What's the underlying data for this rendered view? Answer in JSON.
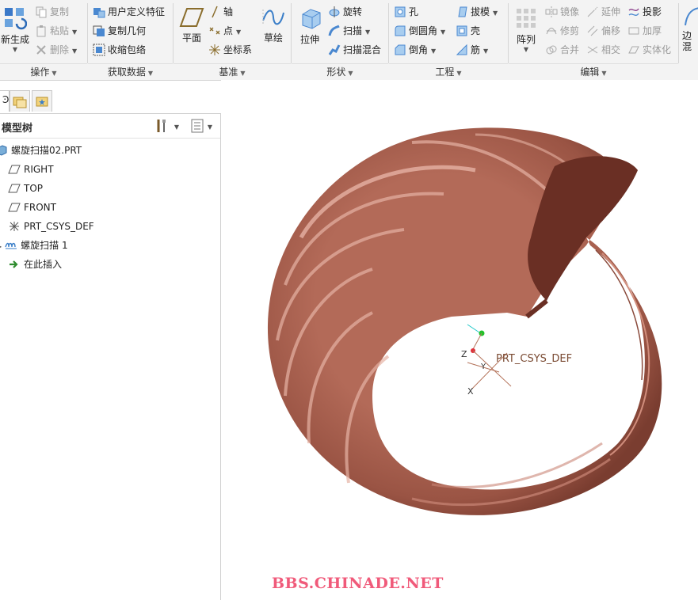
{
  "ribbon": {
    "operations": {
      "group_label": "操作",
      "regenerate_label": "新生成",
      "copy_label": "复制",
      "paste_label": "粘贴",
      "delete_label": "删除"
    },
    "get_data": {
      "group_label": "获取数据",
      "udf_label": "用户定义特征",
      "copy_geom_label": "复制几何",
      "shrinkwrap_label": "收缩包络"
    },
    "datum": {
      "group_label": "基准",
      "plane_label": "平面",
      "axis_label": "轴",
      "point_label": "点",
      "csys_label": "坐标系",
      "sketch_label": "草绘"
    },
    "shapes": {
      "group_label": "形状",
      "extrude_label": "拉伸",
      "revolve_label": "旋转",
      "sweep_label": "扫描",
      "swept_blend_label": "扫描混合"
    },
    "engineering": {
      "group_label": "工程",
      "hole_label": "孔",
      "round_label": "倒圆角",
      "chamfer_label": "倒角",
      "draft_label": "拔模",
      "shell_label": "壳",
      "rib_label": "筋"
    },
    "editing": {
      "group_label": "编辑",
      "pattern_label": "阵列",
      "mirror_label": "镜像",
      "trim_label": "修剪",
      "merge_label": "合并",
      "extend_label": "延伸",
      "offset_label": "偏移",
      "intersect_label": "相交",
      "project_label": "投影",
      "thicken_label": "加厚",
      "solidify_label": "实体化"
    },
    "surfaces": {
      "boundary_label_1": "边",
      "boundary_label_2": "混"
    }
  },
  "left_panel": {
    "tree_title": "模型树",
    "items": [
      {
        "label": "螺旋扫描02.PRT",
        "icon": "part-icon"
      },
      {
        "label": "RIGHT",
        "icon": "datum-plane-icon"
      },
      {
        "label": "TOP",
        "icon": "datum-plane-icon"
      },
      {
        "label": "FRONT",
        "icon": "datum-plane-icon"
      },
      {
        "label": "PRT_CSYS_DEF",
        "icon": "csys-icon"
      },
      {
        "label": "螺旋扫描 1",
        "icon": "helical-sweep-icon"
      },
      {
        "label": "在此插入",
        "icon": "insert-here-arrow-icon"
      }
    ]
  },
  "viewport": {
    "csys_label": "PRT_CSYS_DEF",
    "axis_z": "Z",
    "axis_y": "Y",
    "axis_x": "X",
    "model_color": "#b86d5c",
    "watermark": "BBS.CHINADE.NET"
  },
  "colors": {
    "ribbon_bg": "#f3f3f3",
    "watermark": "#f05a7a",
    "csys_line": "#b4735a"
  }
}
